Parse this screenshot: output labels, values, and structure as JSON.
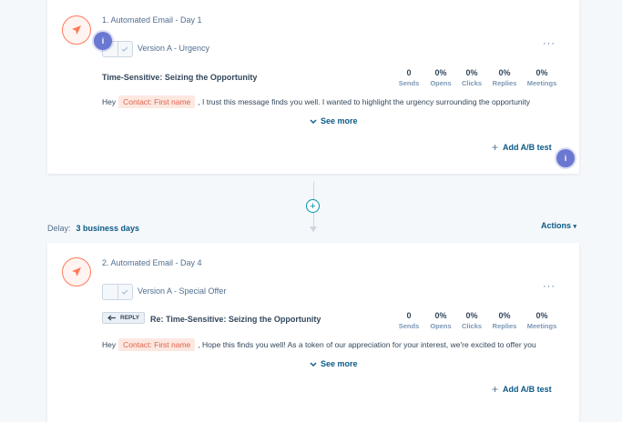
{
  "steps": [
    {
      "title": "1. Automated Email - Day 1",
      "version": "Version A - Urgency",
      "reply_tag": "",
      "subject": "Time-Sensitive: Seizing the Opportunity",
      "stats": [
        {
          "value": "0",
          "label": "Sends"
        },
        {
          "value": "0%",
          "label": "Opens"
        },
        {
          "value": "0%",
          "label": "Clicks"
        },
        {
          "value": "0%",
          "label": "Replies"
        },
        {
          "value": "0%",
          "label": "Meetings"
        }
      ],
      "body_prefix": "Hey",
      "token": "Contact: First name",
      "body_suffix": ", I trust this message finds you well. I wanted to highlight the urgency surrounding the opportunity",
      "see_more": "See more",
      "add_ab": "Add A/B test"
    },
    {
      "title": "2. Automated Email - Day 4",
      "version": "Version A - Special Offer",
      "reply_tag": "REPLY",
      "subject": "Re: Time-Sensitive: Seizing the Opportunity",
      "stats": [
        {
          "value": "0",
          "label": "Sends"
        },
        {
          "value": "0%",
          "label": "Opens"
        },
        {
          "value": "0%",
          "label": "Clicks"
        },
        {
          "value": "0%",
          "label": "Replies"
        },
        {
          "value": "0%",
          "label": "Meetings"
        }
      ],
      "body_prefix": "Hey",
      "token": "Contact: First name",
      "body_suffix": ", Hope this finds you well! As a token of our appreciation for your interest, we're excited to offer you",
      "see_more": "See more",
      "add_ab": "Add A/B test"
    }
  ],
  "delay": {
    "label": "Delay:",
    "value": "3 business days"
  },
  "actions_label": "Actions",
  "info_badge": "i",
  "more_dots": "···",
  "add_step": "+",
  "colors": {
    "accent": "#ff7a59",
    "link": "#0b5a87",
    "badge": "#6a78d1",
    "connector": "#0091ae"
  }
}
